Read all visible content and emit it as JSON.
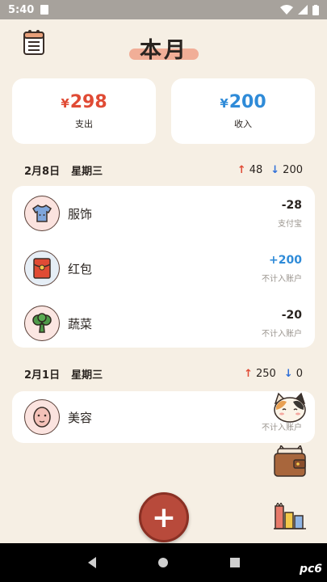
{
  "status_bar": {
    "time": "5:40"
  },
  "header": {
    "title": "本月"
  },
  "summary": {
    "expense": {
      "amount": "298",
      "currency": "¥",
      "label": "支出"
    },
    "income": {
      "amount": "200",
      "currency": "¥",
      "label": "收入"
    }
  },
  "days": [
    {
      "date": "2月8日",
      "weekday": "星期三",
      "up_arrow": "↑",
      "up": "48",
      "down_arrow": "↓",
      "down": "200",
      "transactions": [
        {
          "name": "服饰",
          "amount": "-28",
          "sub": "支付宝",
          "icon": "clothing-icon"
        },
        {
          "name": "红包",
          "amount": "+200",
          "sub": "不计入账户",
          "icon": "red-envelope-icon"
        },
        {
          "name": "蔬菜",
          "amount": "-20",
          "sub": "不计入账户",
          "icon": "vegetable-icon"
        }
      ]
    },
    {
      "date": "2月1日",
      "weekday": "星期三",
      "up_arrow": "↑",
      "up": "250",
      "down_arrow": "↓",
      "down": "0",
      "transactions": [
        {
          "name": "美容",
          "amount": "",
          "sub": "不计入账户",
          "icon": "beauty-icon"
        }
      ]
    }
  ],
  "fab": {
    "label": "+"
  },
  "watermark": "pc6",
  "colors": {
    "background": "#f6efe4",
    "expense": "#e04b35",
    "income": "#2f8bd8",
    "fab": "#b84a3b"
  }
}
